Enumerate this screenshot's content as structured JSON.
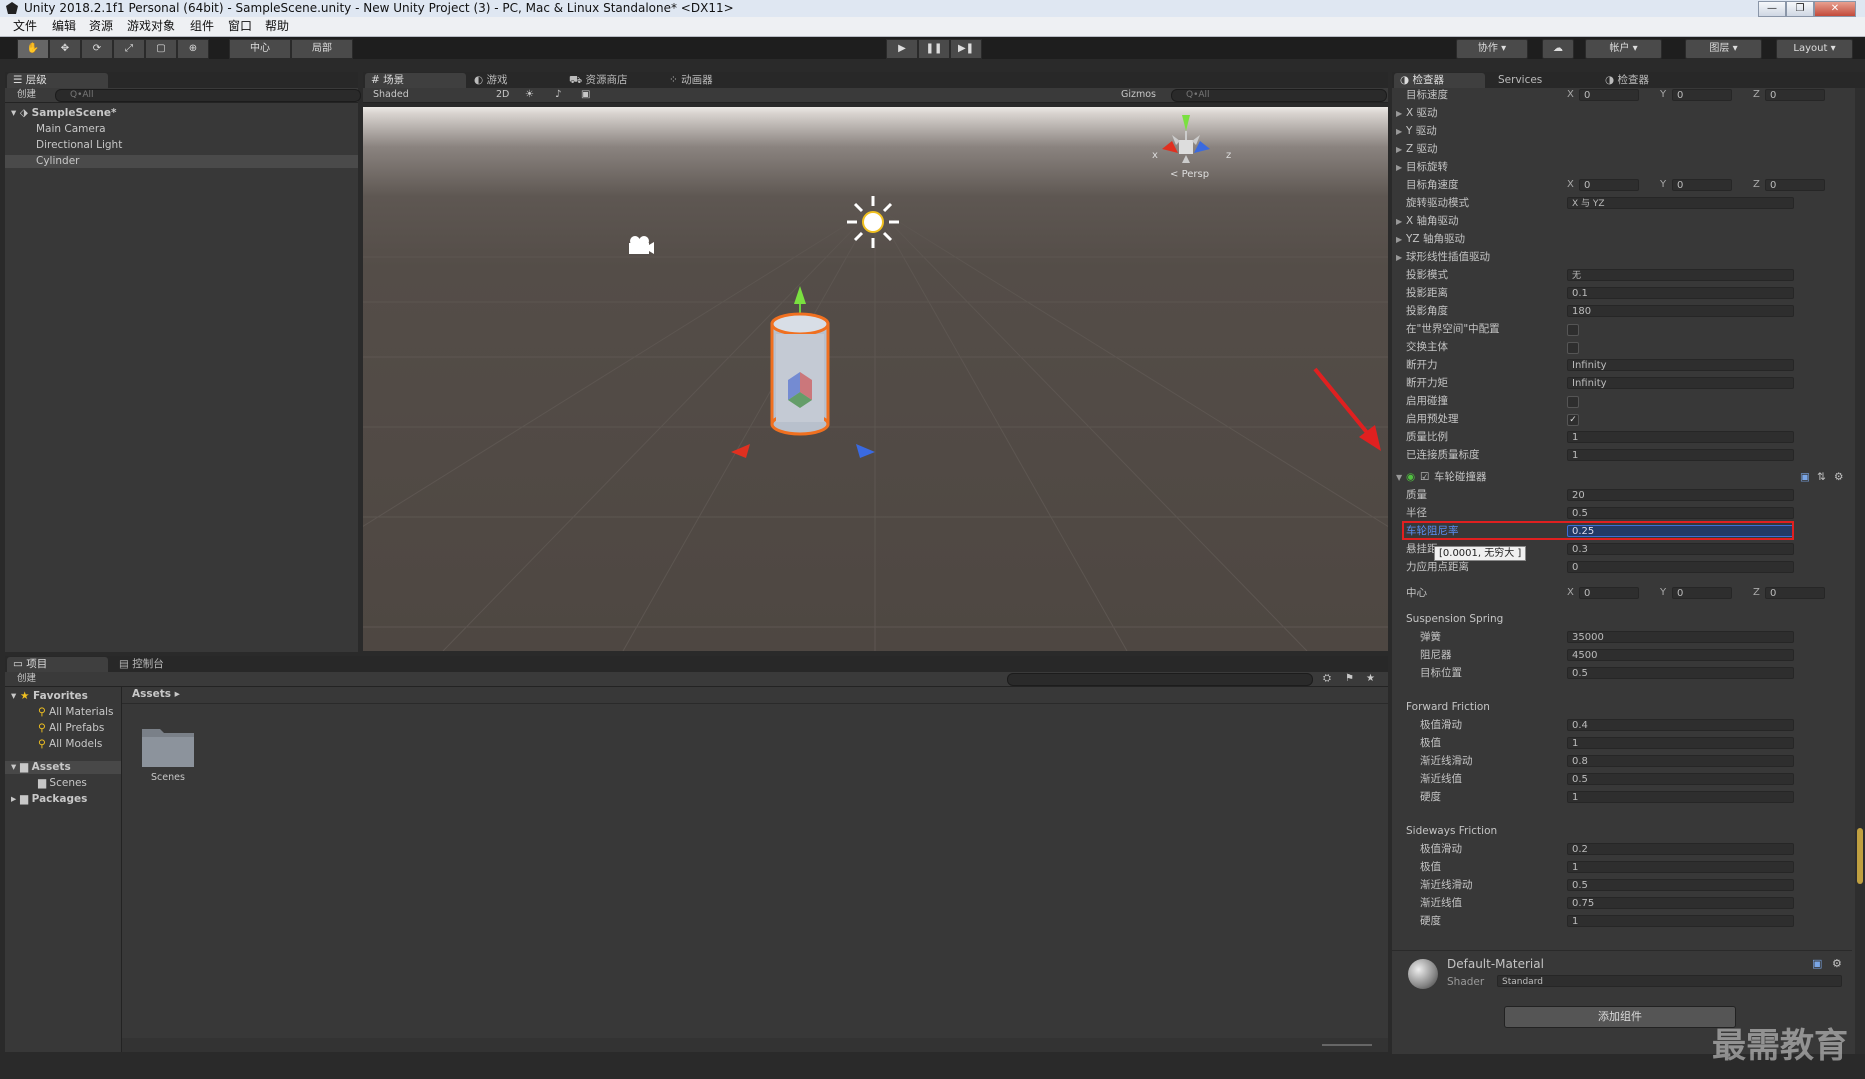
{
  "window": {
    "title": "Unity 2018.2.1f1 Personal (64bit) - SampleScene.unity - New Unity Project (3) - PC, Mac & Linux Standalone* <DX11>"
  },
  "menu": [
    "文件",
    "编辑",
    "资源",
    "游戏对象",
    "组件",
    "窗口",
    "帮助"
  ],
  "toolbar": {
    "pivot_label": "中心",
    "space_label": "局部",
    "collab_label": "协作",
    "account_label": "帐户",
    "layers_label": "图层",
    "layout_label": "Layout"
  },
  "hierarchy": {
    "tab": "层级",
    "create": "创建",
    "search_placeholder": "Q•All",
    "scene": "SampleScene*",
    "items": [
      "Main Camera",
      "Directional Light",
      "Cylinder"
    ]
  },
  "scene_view": {
    "tabs": [
      "场景",
      "游戏",
      "资源商店",
      "动画器"
    ],
    "shading": "Shaded",
    "mode_2d": "2D",
    "gizmos": "Gizmos",
    "search_placeholder": "Q•All",
    "persp": "Persp",
    "axis_x": "x",
    "axis_z": "z"
  },
  "project": {
    "tabs": [
      "项目",
      "控制台"
    ],
    "create": "创建",
    "favorites": "Favorites",
    "favorites_items": [
      "All Materials",
      "All Prefabs",
      "All Models"
    ],
    "assets": "Assets",
    "assets_items": [
      "Scenes"
    ],
    "packages": "Packages",
    "breadcrumb": "Assets",
    "folder": "Scenes"
  },
  "inspector": {
    "tabs": [
      "检查器",
      "Services",
      "检查器"
    ],
    "rows_top": [
      {
        "type": "xyz",
        "label": "目标速度",
        "x": "0",
        "y": "0",
        "z": "0"
      },
      {
        "type": "fold",
        "label": "X 驱动"
      },
      {
        "type": "fold",
        "label": "Y 驱动"
      },
      {
        "type": "fold",
        "label": "Z 驱动"
      },
      {
        "type": "fold",
        "label": "目标旋转"
      },
      {
        "type": "xyz",
        "label": "目标角速度",
        "x": "0",
        "y": "0",
        "z": "0"
      },
      {
        "type": "field",
        "label": "旋转驱动模式",
        "value": "X 与 YZ"
      },
      {
        "type": "fold",
        "label": "X 轴角驱动"
      },
      {
        "type": "fold",
        "label": "YZ 轴角驱动"
      },
      {
        "type": "fold",
        "label": "球形线性插值驱动"
      },
      {
        "type": "field",
        "label": "投影模式",
        "value": "无"
      },
      {
        "type": "field",
        "label": "投影距离",
        "value": "0.1"
      },
      {
        "type": "field",
        "label": "投影角度",
        "value": "180"
      },
      {
        "type": "check",
        "label": "在\"世界空间\"中配置",
        "checked": false
      },
      {
        "type": "check",
        "label": "交换主体",
        "checked": false
      },
      {
        "type": "field",
        "label": "断开力",
        "value": "Infinity"
      },
      {
        "type": "field",
        "label": "断开力矩",
        "value": "Infinity"
      },
      {
        "type": "check",
        "label": "启用碰撞",
        "checked": false
      },
      {
        "type": "check",
        "label": "启用预处理",
        "checked": true
      },
      {
        "type": "field",
        "label": "质量比例",
        "value": "1"
      },
      {
        "type": "field",
        "label": "已连接质量标度",
        "value": "1"
      }
    ],
    "wheel": {
      "component": "车轮碰撞器",
      "mass_label": "质量",
      "mass": "20",
      "radius_label": "半径",
      "radius": "0.5",
      "damping_label": "车轮阻尼率",
      "damping": "0.25",
      "suspension_label": "悬挂距",
      "suspension": "0.3",
      "tooltip": "[0.0001, 无穷大 ]",
      "force_label": "力应用点距离",
      "force": "0",
      "center_label": "中心",
      "cx": "0",
      "cy": "0",
      "cz": "0",
      "spring_section": "Suspension Spring",
      "spring": [
        {
          "label": "弹簧",
          "value": "35000"
        },
        {
          "label": "阻尼器",
          "value": "4500"
        },
        {
          "label": "目标位置",
          "value": "0.5"
        }
      ],
      "forward_section": "Forward Friction",
      "forward": [
        {
          "label": "极值滑动",
          "value": "0.4"
        },
        {
          "label": "极值",
          "value": "1"
        },
        {
          "label": "渐近线滑动",
          "value": "0.8"
        },
        {
          "label": "渐近线值",
          "value": "0.5"
        },
        {
          "label": "硬度",
          "value": "1"
        }
      ],
      "sideways_section": "Sideways Friction",
      "sideways": [
        {
          "label": "极值滑动",
          "value": "0.2"
        },
        {
          "label": "极值",
          "value": "1"
        },
        {
          "label": "渐近线滑动",
          "value": "0.5"
        },
        {
          "label": "渐近线值",
          "value": "0.75"
        },
        {
          "label": "硬度",
          "value": "1"
        }
      ]
    },
    "material": {
      "name": "Default-Material",
      "shader_label": "Shader",
      "shader": "Standard"
    },
    "add_component": "添加组件"
  },
  "watermark": "最需教育",
  "colors": {
    "highlight_red": "#e02020",
    "selection_blue": "#3d6ed8",
    "object_orange": "#f07020"
  }
}
